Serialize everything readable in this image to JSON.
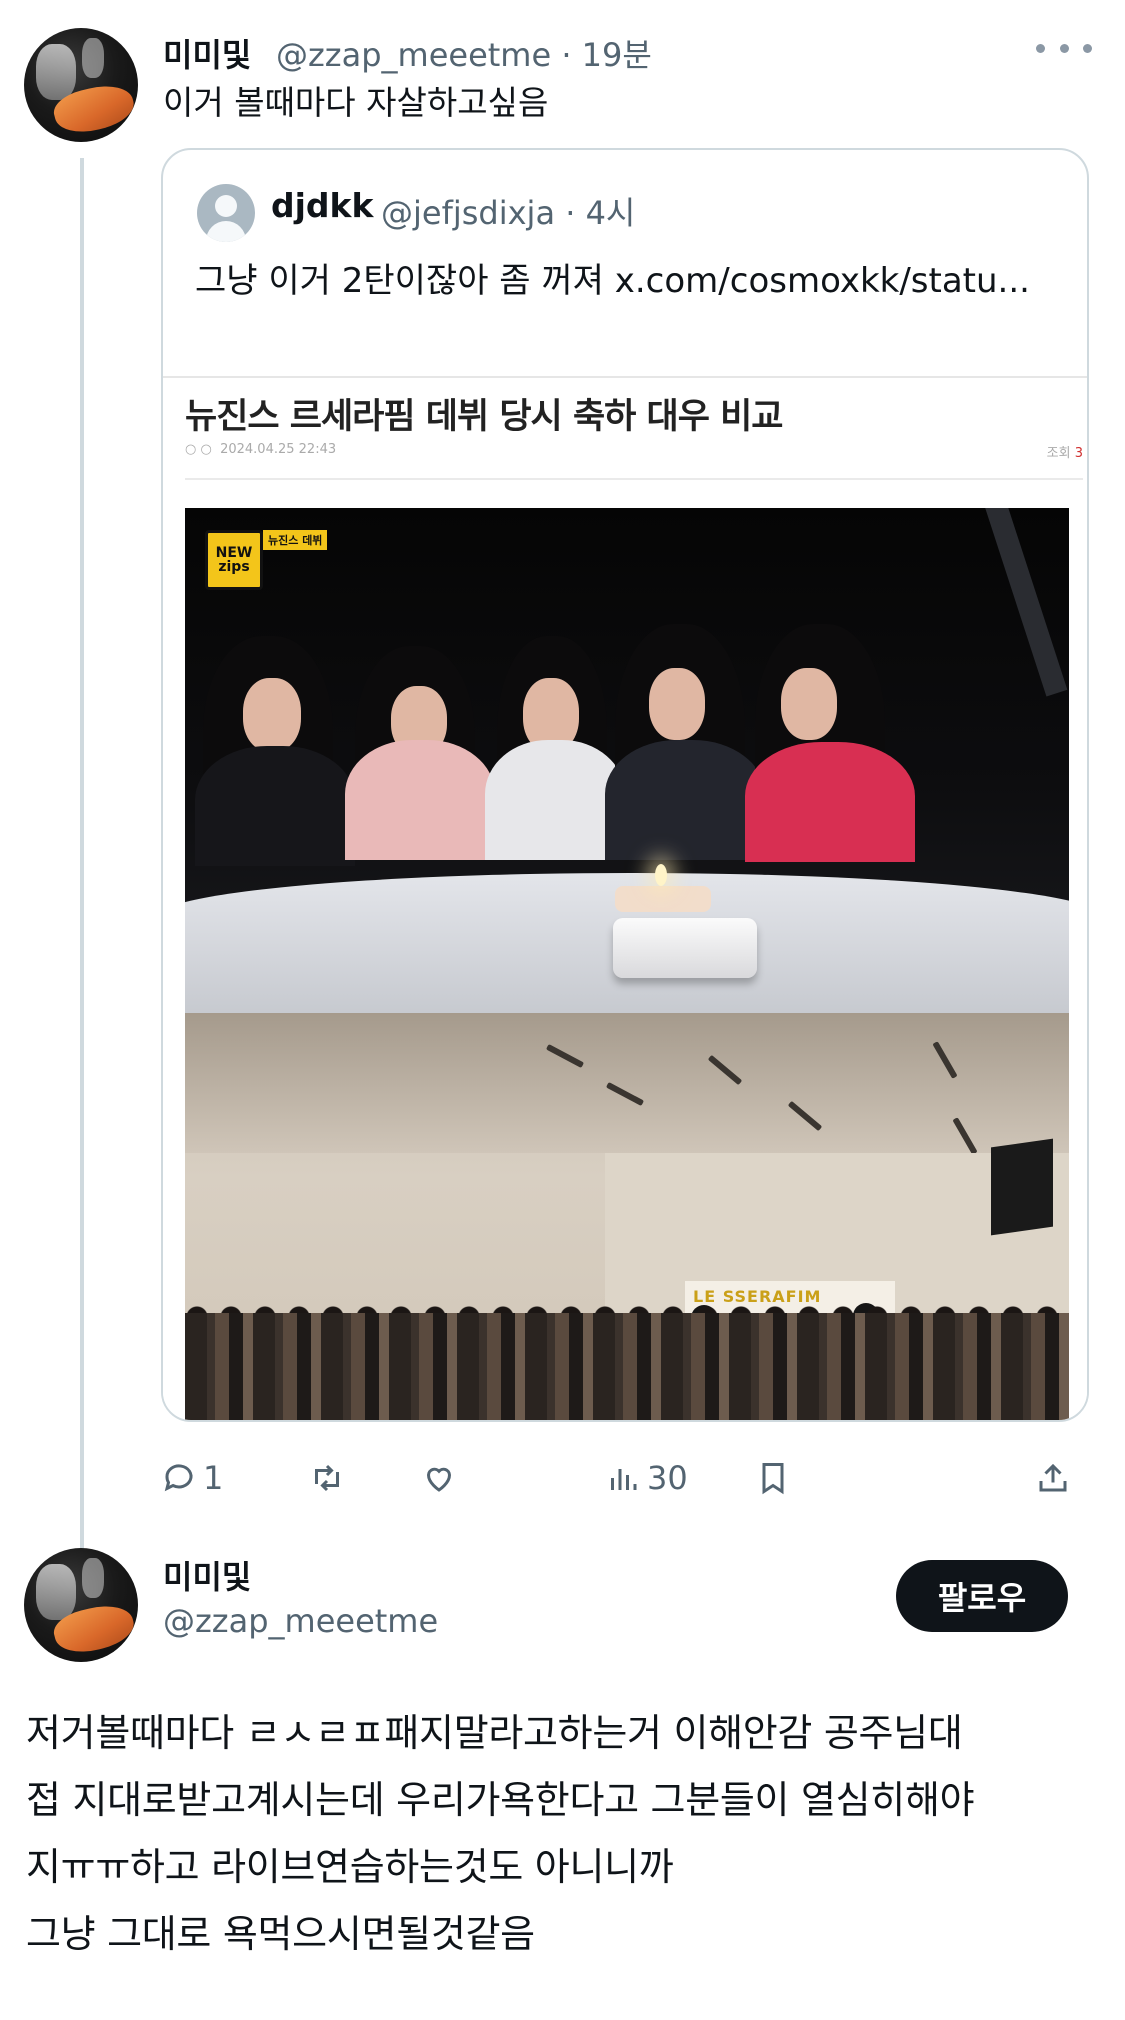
{
  "reply": {
    "display_name": "미미및",
    "handle": "@zzap_meeetme",
    "time": "· 19분",
    "text": "이거 볼때마다 자살하고싶음"
  },
  "quoted": {
    "display_name": "djdkk",
    "handle": "@jefjsdixja",
    "time": "· 4시",
    "text": "그냥 이거 2탄이잖아 좀 꺼져 x.com/cosmoxkk/statu...",
    "image": {
      "article_title": "뉴진스 르세라핌 데뷔 당시 축하 대우 비교",
      "article_date": "2024.04.25 22:43",
      "article_views_label": "조회",
      "article_views_value": "3",
      "badge_logo": "NEW zips",
      "badge_tag": "뉴진스 데뷔",
      "banner_text": "LE SSERAFIM"
    }
  },
  "actions": {
    "replies": "1",
    "retweets": "",
    "likes": "",
    "views": "30"
  },
  "main_post": {
    "display_name": "미미및",
    "handle": "@zzap_meeetme",
    "follow_label": "팔로우",
    "text": "저거볼때마다 ㄹㅅㄹㅍ패지말라고하는거 이해안감 공주님대\n접 지대로받고계시는데 우리가욕한다고 그분들이 열심히해야\n지ㅠㅠ하고 라이브연습하는것도 아니니까\n그냥 그대로 욕먹으시면될것같음"
  },
  "colors": {
    "text_primary": "#0f1419",
    "text_secondary": "#536471",
    "border": "#cfd9de",
    "button_bg": "#0f1419"
  },
  "icons": [
    "more-icon",
    "reply-icon",
    "retweet-icon",
    "like-icon",
    "views-icon",
    "bookmark-icon",
    "share-icon",
    "default-avatar-icon"
  ]
}
